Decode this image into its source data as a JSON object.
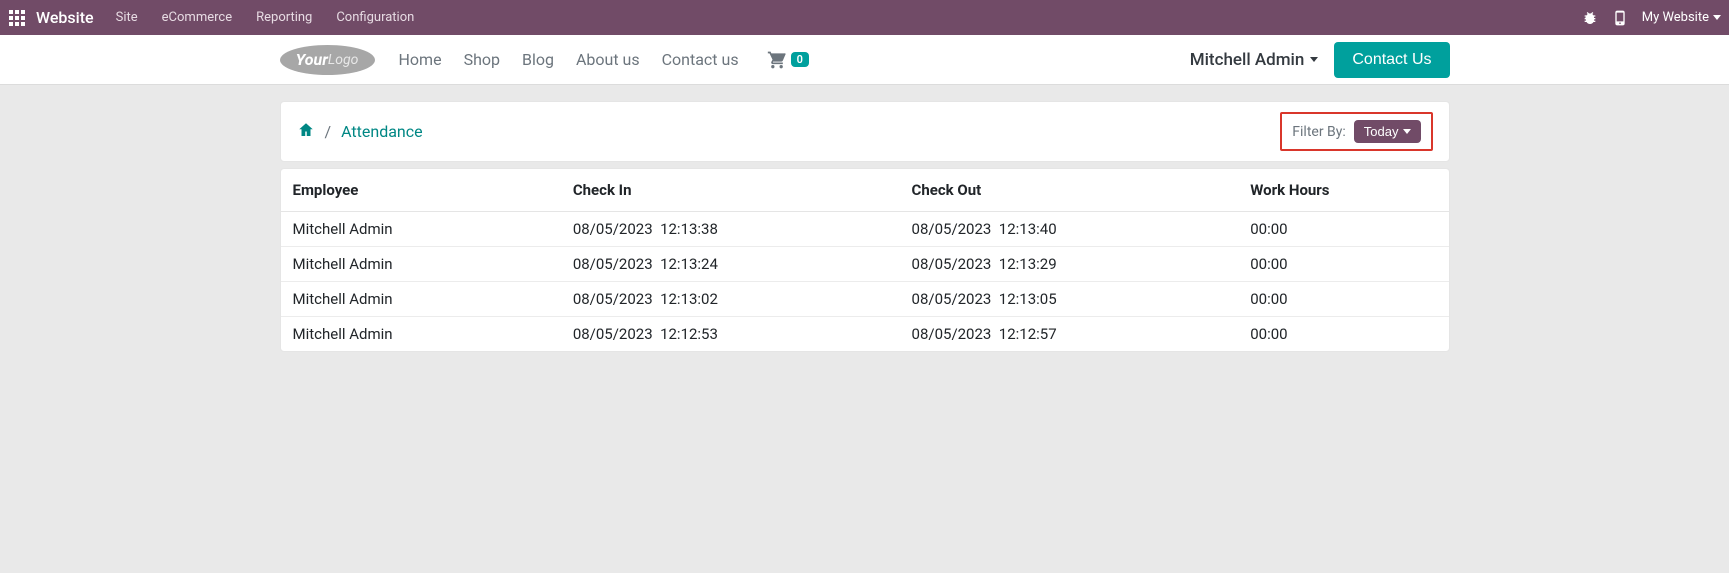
{
  "topbar": {
    "app_name": "Website",
    "menu": [
      "Site",
      "eCommerce",
      "Reporting",
      "Configuration"
    ],
    "my_website": "My Website"
  },
  "site_nav": {
    "items": [
      "Home",
      "Shop",
      "Blog",
      "About us",
      "Contact us"
    ],
    "cart_count": "0",
    "user": "Mitchell Admin",
    "contact_btn": "Contact Us"
  },
  "breadcrumb": {
    "current": "Attendance",
    "filter_label": "Filter By:",
    "filter_value": "Today"
  },
  "table": {
    "headers": [
      "Employee",
      "Check In",
      "Check Out",
      "Work Hours"
    ],
    "rows": [
      {
        "employee": "Mitchell Admin",
        "check_in": "08/05/2023  12:13:38",
        "check_out": "08/05/2023  12:13:40",
        "work_hours": "00:00"
      },
      {
        "employee": "Mitchell Admin",
        "check_in": "08/05/2023  12:13:24",
        "check_out": "08/05/2023  12:13:29",
        "work_hours": "00:00"
      },
      {
        "employee": "Mitchell Admin",
        "check_in": "08/05/2023  12:13:02",
        "check_out": "08/05/2023  12:13:05",
        "work_hours": "00:00"
      },
      {
        "employee": "Mitchell Admin",
        "check_in": "08/05/2023  12:12:53",
        "check_out": "08/05/2023  12:12:57",
        "work_hours": "00:00"
      }
    ]
  }
}
